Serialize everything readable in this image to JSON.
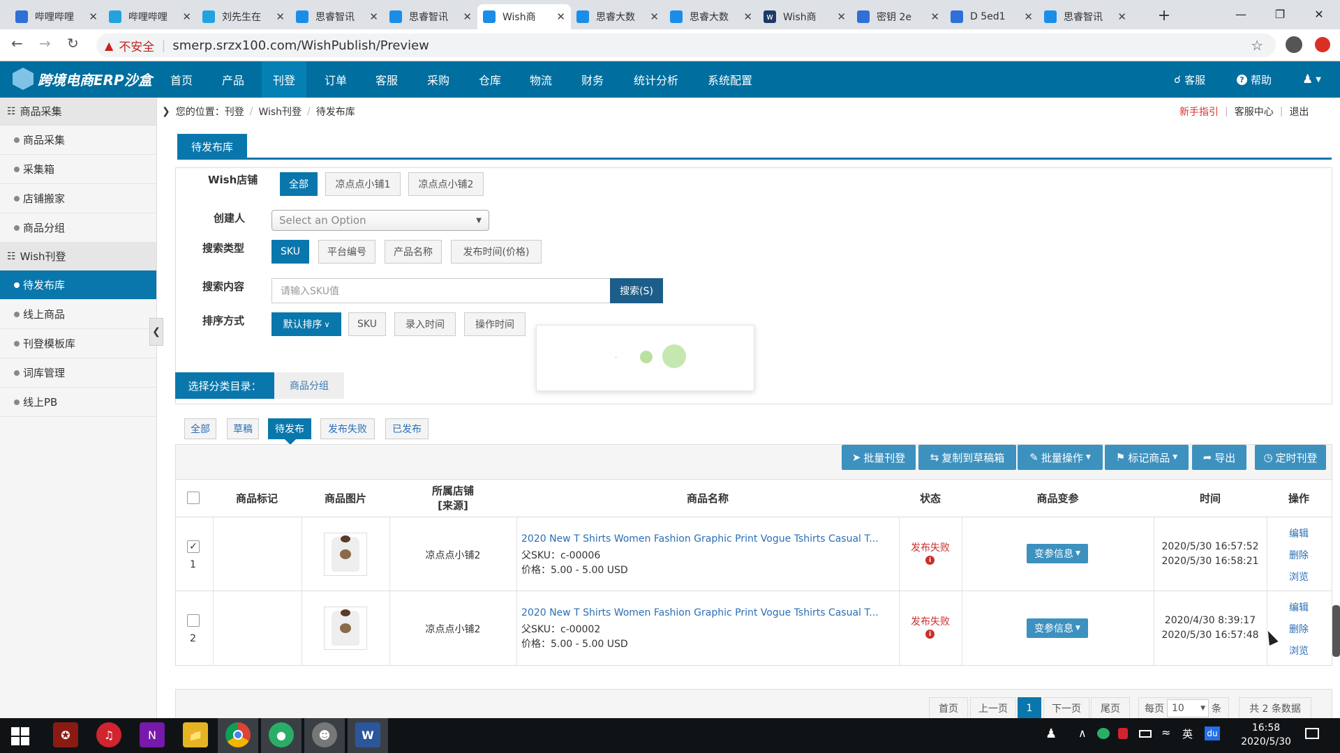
{
  "browser": {
    "tabs": [
      {
        "title": "哔哩哔哩",
        "icon": "paw-icon",
        "color": "#2f6fd6"
      },
      {
        "title": "哔哩哔哩",
        "icon": "tv-icon",
        "color": "#22a3e0"
      },
      {
        "title": "刘先生在",
        "icon": "tv-icon",
        "color": "#22a3e0"
      },
      {
        "title": "思睿智讯",
        "icon": "app-icon",
        "color": "#1a8de9"
      },
      {
        "title": "思睿智讯",
        "icon": "app-icon",
        "color": "#1a8de9"
      },
      {
        "title": "Wish商",
        "icon": "app-icon",
        "color": "#1a8de9"
      },
      {
        "title": "思睿大数",
        "icon": "app-icon",
        "color": "#1a8de9"
      },
      {
        "title": "思睿大数",
        "icon": "app-icon",
        "color": "#1a8de9"
      },
      {
        "title": "Wish商",
        "icon": "wish-icon",
        "color": "#1d3a66"
      },
      {
        "title": "密钥 2e",
        "icon": "paw-icon",
        "color": "#2f6fd6"
      },
      {
        "title": "D 5ed1",
        "icon": "paw-icon",
        "color": "#2f6fd6"
      },
      {
        "title": "思睿智讯",
        "icon": "app-icon",
        "color": "#1a8de9"
      }
    ],
    "active_tab": 5,
    "security_label": "不安全",
    "url": "smerp.srzx100.com/WishPublish/Preview"
  },
  "app": {
    "logo_text": "跨境电商ERP沙盒",
    "nav": [
      "首页",
      "产品",
      "刊登",
      "订单",
      "客服",
      "采购",
      "仓库",
      "物流",
      "财务",
      "统计分析",
      "系统配置"
    ],
    "nav_active": 2,
    "right_links": [
      "客服",
      "帮助"
    ]
  },
  "sidebar": {
    "groups": [
      {
        "title": "商品采集",
        "items": [
          "商品采集",
          "采集箱",
          "店铺搬家",
          "商品分组"
        ]
      },
      {
        "title": "Wish刊登",
        "items": [
          "待发布库",
          "线上商品",
          "刊登模板库",
          "词库管理",
          "线上PB"
        ]
      }
    ],
    "active_item": "待发布库"
  },
  "breadcrumb": {
    "prefix": "您的位置：",
    "items": [
      "刊登",
      "Wish刊登",
      "待发布库"
    ],
    "right_links": [
      "新手指引",
      "客服中心",
      "退出"
    ]
  },
  "page_tab": "待发布库",
  "filters": {
    "shop_label": "Wish店铺",
    "shops": [
      "全部",
      "凉点点小铺1",
      "凉点点小铺2"
    ],
    "creator_label": "创建人",
    "creator_placeholder": "Select an Option",
    "search_type_label": "搜索类型",
    "search_types": [
      "SKU",
      "平台编号",
      "产品名称",
      "发布时间(价格)"
    ],
    "content_label": "搜索内容",
    "content_placeholder": "请输入SKU值",
    "search_button": "搜索(S)",
    "sort_label": "排序方式",
    "sorts": [
      "默认排序",
      "SKU",
      "录入时间",
      "操作时间"
    ],
    "category_label": "选择分类目录：",
    "category_button": "商品分组"
  },
  "status_tabs": [
    "全部",
    "草稿",
    "待发布",
    "发布失败",
    "已发布"
  ],
  "status_active": 2,
  "toolbar": [
    "批量刊登",
    "复制到草稿箱",
    "批量操作",
    "标记商品",
    "导出",
    "定时刊登"
  ],
  "table": {
    "headers": [
      "商品标记",
      "商品图片",
      "所属店铺\n[来源]",
      "商品名称",
      "状态",
      "商品变参",
      "时间",
      "操作"
    ],
    "rows": [
      {
        "index": "1",
        "checked": true,
        "shop": "凉点点小铺2",
        "name": "2020 New T Shirts Women Fashion Graphic Print Vogue Tshirts Casual T...",
        "parent_sku": "父SKU：c-00006",
        "price": "价格：5.00 - 5.00 USD",
        "status": "发布失败",
        "variant_button": "变参信息",
        "time1": "2020/5/30 16:57:52",
        "time2": "2020/5/30 16:58:21",
        "actions": [
          "编辑",
          "删除",
          "浏览"
        ]
      },
      {
        "index": "2",
        "checked": false,
        "shop": "凉点点小铺2",
        "name": "2020 New T Shirts Women Fashion Graphic Print Vogue Tshirts Casual T...",
        "parent_sku": "父SKU：c-00002",
        "price": "价格：5.00 - 5.00 USD",
        "status": "发布失败",
        "variant_button": "变参信息",
        "time1": "2020/4/30 8:39:17",
        "time2": "2020/5/30 16:57:48",
        "actions": [
          "编辑",
          "删除",
          "浏览"
        ]
      }
    ]
  },
  "pagination": {
    "first": "首页",
    "prev": "上一页",
    "current": "1",
    "next": "下一页",
    "last": "尾页",
    "per_page_label": "每页",
    "per_page": "10",
    "unit": "条",
    "total": "共 2 条数据"
  },
  "taskbar": {
    "time": "16:58",
    "date": "2020/5/30",
    "ime": "英"
  },
  "colors": {
    "primary": "#006e9f",
    "accent": "#0a77ac",
    "fail": "#c9302c",
    "link": "#2a6fb5"
  }
}
